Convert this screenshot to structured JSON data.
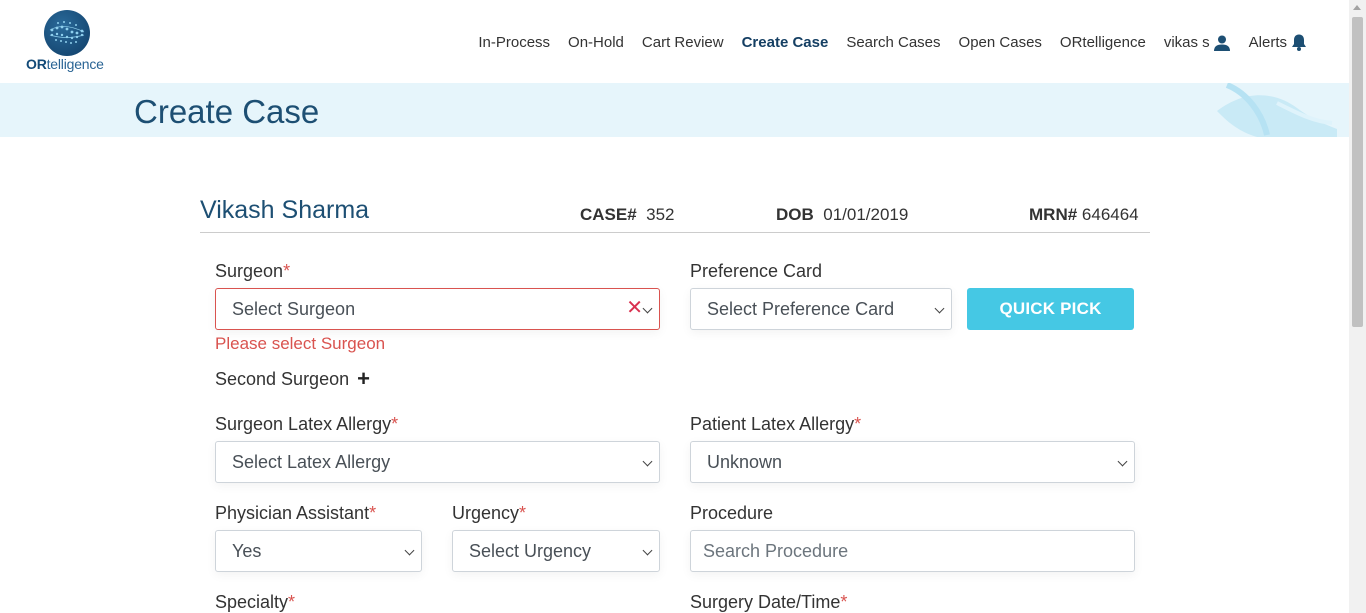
{
  "brand": {
    "logo_bold": "OR",
    "logo_rest": "telligence"
  },
  "nav": {
    "items": [
      "In-Process",
      "On-Hold",
      "Cart Review",
      "Create Case",
      "Search Cases",
      "Open Cases",
      "ORtelligence"
    ],
    "user": "vikas s",
    "alerts": "Alerts"
  },
  "page": {
    "title": "Create Case"
  },
  "patient": {
    "name": "Vikash Sharma",
    "case_label": "CASE#",
    "case_value": "352",
    "dob_label": "DOB",
    "dob_value": "01/01/2019",
    "mrn_label": "MRN#",
    "mrn_value": "646464"
  },
  "form": {
    "surgeon_label": "Surgeon",
    "surgeon_placeholder": "Select Surgeon",
    "surgeon_error": "Please select Surgeon",
    "pref_label": "Preference Card",
    "pref_placeholder": "Select Preference Card",
    "quick_pick": "QUICK PICK",
    "second_surgeon": "Second Surgeon",
    "surgeon_latex_label": "Surgeon Latex Allergy",
    "surgeon_latex_value": "Select Latex Allergy",
    "patient_latex_label": "Patient Latex Allergy",
    "patient_latex_value": "Unknown",
    "pa_label": "Physician Assistant",
    "pa_value": "Yes",
    "urgency_label": "Urgency",
    "urgency_value": "Select Urgency",
    "procedure_label": "Procedure",
    "procedure_placeholder": "Search Procedure",
    "specialty_label": "Specialty",
    "surgery_date_label": "Surgery Date/Time",
    "required_mark": "*"
  },
  "colors": {
    "primary": "#1d4f73",
    "accent": "#45c8e4",
    "error": "#d9534f",
    "banner": "#e6f5fb"
  }
}
